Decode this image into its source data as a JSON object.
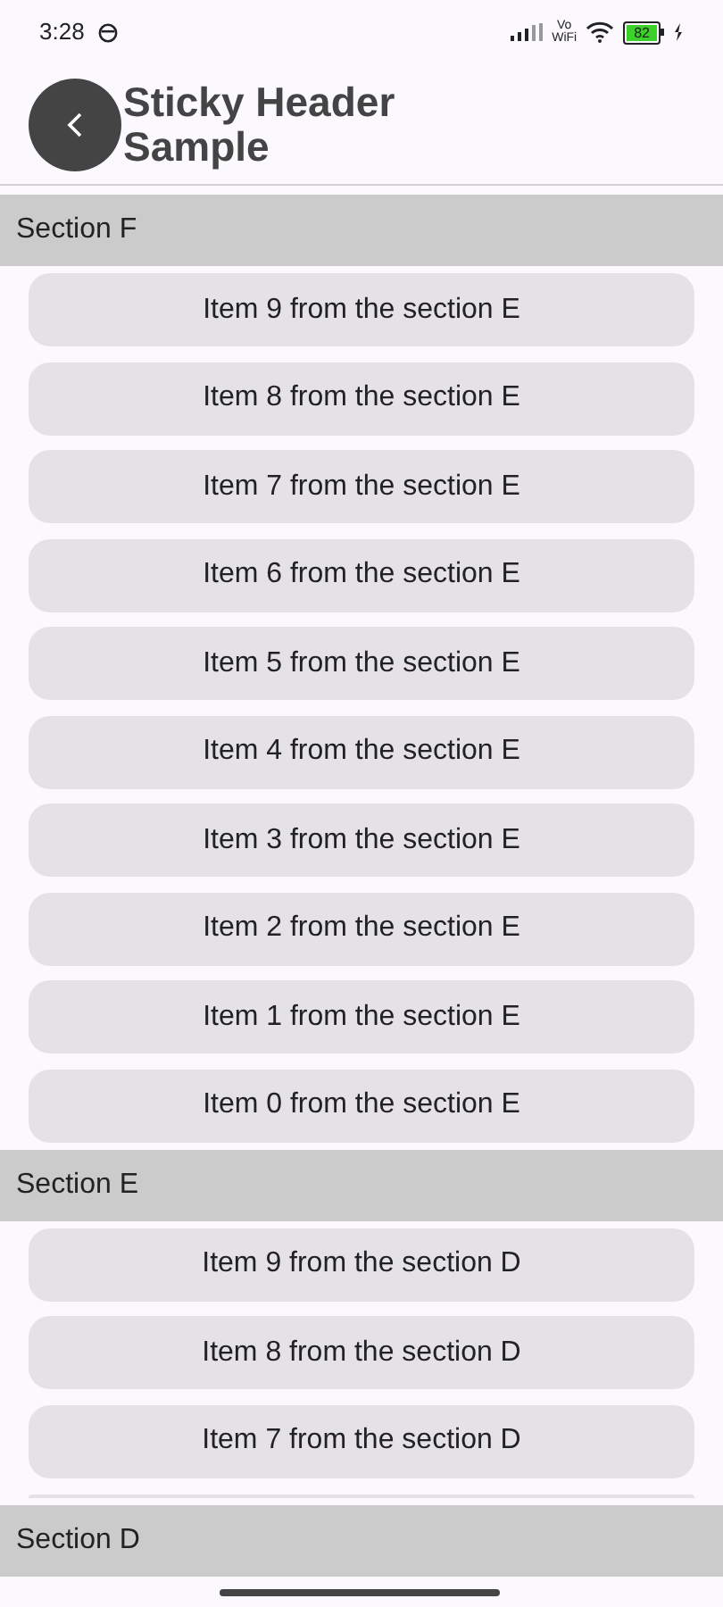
{
  "status_bar": {
    "time": "3:28",
    "network": "Vo\nWiFi",
    "battery": "82"
  },
  "app_bar": {
    "title": "Sticky Header\nSample"
  },
  "sections": [
    {
      "header": "Section F",
      "items": [
        "Item 9 from the section E",
        "Item 8 from the section E",
        "Item 7 from the section E",
        "Item 6 from the section E",
        "Item 5 from the section E",
        "Item 4 from the section E",
        "Item 3 from the section E",
        "Item 2 from the section E",
        "Item 1 from the section E",
        "Item 0 from the section E"
      ]
    },
    {
      "header": "Section E",
      "items": [
        "Item 9 from the section D",
        "Item 8 from the section D",
        "Item 7 from the section D"
      ]
    },
    {
      "header": "Section D"
    }
  ]
}
